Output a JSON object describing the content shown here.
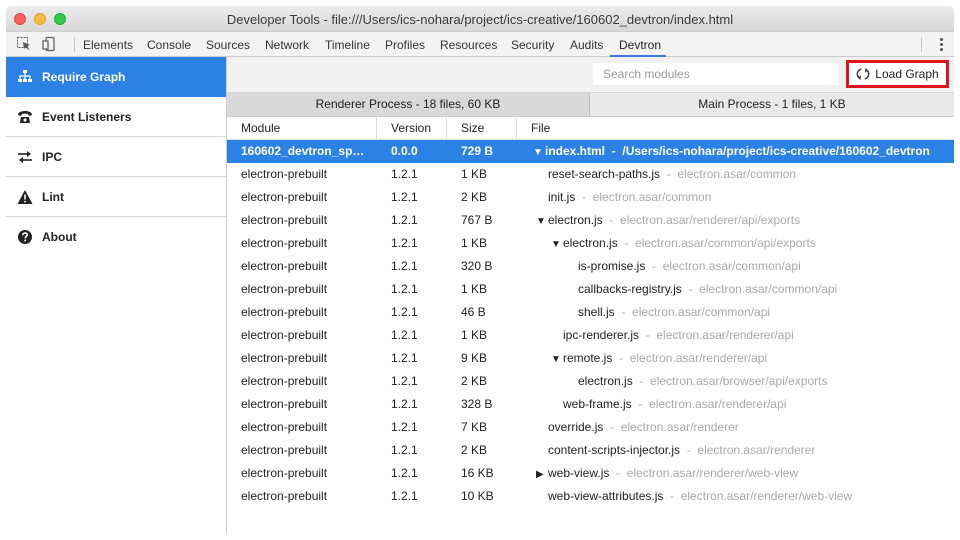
{
  "window": {
    "title": "Developer Tools - file:///Users/ics-nohara/project/ics-creative/160602_devtron/index.html"
  },
  "toolbar": {
    "tabs": [
      "Elements",
      "Console",
      "Sources",
      "Network",
      "Timeline",
      "Profiles",
      "Resources",
      "Security",
      "Audits",
      "Devtron"
    ],
    "active_tab": "Devtron"
  },
  "sidebar": {
    "items": [
      {
        "label": "Require Graph",
        "icon": "sitemap-icon",
        "active": true
      },
      {
        "label": "Event Listeners",
        "icon": "phone-icon"
      },
      {
        "label": "IPC",
        "icon": "exchange-icon"
      },
      {
        "label": "Lint",
        "icon": "warning-icon"
      },
      {
        "label": "About",
        "icon": "question-icon"
      }
    ]
  },
  "search": {
    "placeholder": "Search modules",
    "value": ""
  },
  "load_button": {
    "label": "Load Graph",
    "icon": "refresh-icon",
    "highlight_color": "#e0141c"
  },
  "process_tabs": [
    {
      "label": "Renderer Process - 18 files, 60 KB",
      "active": true
    },
    {
      "label": "Main Process - 1 files, 1 KB",
      "active": false
    }
  ],
  "table": {
    "columns": [
      "Module",
      "Version",
      "Size",
      "File"
    ],
    "rows": [
      {
        "module": "160602_devtron_spe...",
        "version": "0.0.0",
        "size": "729 B",
        "depth": 0,
        "arrow": "down",
        "file": "index.html",
        "dir": "/Users/ics-nohara/project/ics-creative/160602_devtron",
        "selected": true
      },
      {
        "module": "electron-prebuilt",
        "version": "1.2.1",
        "size": "1 KB",
        "depth": 1,
        "arrow": "",
        "file": "reset-search-paths.js",
        "dir": "electron.asar/common"
      },
      {
        "module": "electron-prebuilt",
        "version": "1.2.1",
        "size": "2 KB",
        "depth": 1,
        "arrow": "",
        "file": "init.js",
        "dir": "electron.asar/common"
      },
      {
        "module": "electron-prebuilt",
        "version": "1.2.1",
        "size": "767 B",
        "depth": 1,
        "arrow": "down",
        "file": "electron.js",
        "dir": "electron.asar/renderer/api/exports"
      },
      {
        "module": "electron-prebuilt",
        "version": "1.2.1",
        "size": "1 KB",
        "depth": 2,
        "arrow": "down",
        "file": "electron.js",
        "dir": "electron.asar/common/api/exports"
      },
      {
        "module": "electron-prebuilt",
        "version": "1.2.1",
        "size": "320 B",
        "depth": 3,
        "arrow": "",
        "file": "is-promise.js",
        "dir": "electron.asar/common/api"
      },
      {
        "module": "electron-prebuilt",
        "version": "1.2.1",
        "size": "1 KB",
        "depth": 3,
        "arrow": "",
        "file": "callbacks-registry.js",
        "dir": "electron.asar/common/api"
      },
      {
        "module": "electron-prebuilt",
        "version": "1.2.1",
        "size": "46 B",
        "depth": 3,
        "arrow": "",
        "file": "shell.js",
        "dir": "electron.asar/common/api"
      },
      {
        "module": "electron-prebuilt",
        "version": "1.2.1",
        "size": "1 KB",
        "depth": 2,
        "arrow": "",
        "file": "ipc-renderer.js",
        "dir": "electron.asar/renderer/api"
      },
      {
        "module": "electron-prebuilt",
        "version": "1.2.1",
        "size": "9 KB",
        "depth": 2,
        "arrow": "down",
        "file": "remote.js",
        "dir": "electron.asar/renderer/api"
      },
      {
        "module": "electron-prebuilt",
        "version": "1.2.1",
        "size": "2 KB",
        "depth": 3,
        "arrow": "",
        "file": "electron.js",
        "dir": "electron.asar/browser/api/exports"
      },
      {
        "module": "electron-prebuilt",
        "version": "1.2.1",
        "size": "328 B",
        "depth": 2,
        "arrow": "",
        "file": "web-frame.js",
        "dir": "electron.asar/renderer/api"
      },
      {
        "module": "electron-prebuilt",
        "version": "1.2.1",
        "size": "7 KB",
        "depth": 1,
        "arrow": "",
        "file": "override.js",
        "dir": "electron.asar/renderer"
      },
      {
        "module": "electron-prebuilt",
        "version": "1.2.1",
        "size": "2 KB",
        "depth": 1,
        "arrow": "",
        "file": "content-scripts-injector.js",
        "dir": "electron.asar/renderer"
      },
      {
        "module": "electron-prebuilt",
        "version": "1.2.1",
        "size": "16 KB",
        "depth": 1,
        "arrow": "right",
        "file": "web-view.js",
        "dir": "electron.asar/renderer/web-view"
      },
      {
        "module": "electron-prebuilt",
        "version": "1.2.1",
        "size": "10 KB",
        "depth": 1,
        "arrow": "",
        "file": "web-view-attributes.js",
        "dir": "electron.asar/renderer/web-view"
      }
    ]
  },
  "colors": {
    "accent": "#2b82e4",
    "dir_text": "#a9a9a9"
  }
}
